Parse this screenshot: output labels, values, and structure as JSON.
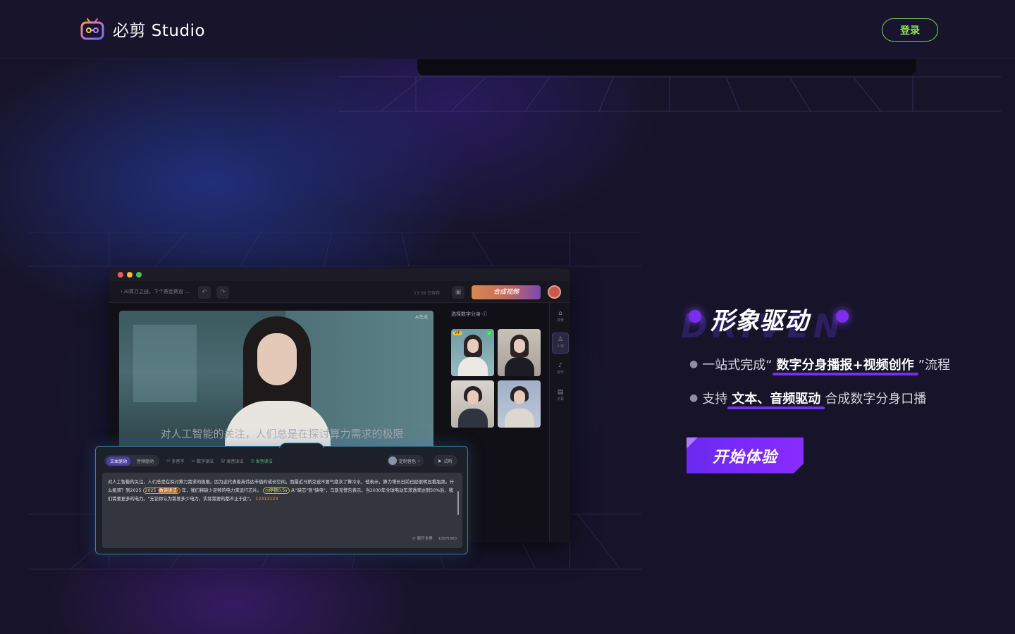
{
  "header": {
    "brand": "必剪 Studio",
    "login_label": "登录"
  },
  "app": {
    "back_label": "AI算力之战，下个赛金赛道 ...",
    "saved_label": "13:56 已保存",
    "compose_label": "合成视频",
    "preview_tag": "AI生成",
    "caption": "对人工智能的关注，人们总是在探讨算力需求的极限",
    "sidebar_title": "选择数字分身",
    "vip_label": "VIP",
    "rail": [
      {
        "label": "背景",
        "icon": "⌂"
      },
      {
        "label": "人物",
        "icon": "♙"
      },
      {
        "label": "音乐",
        "icon": "♪"
      },
      {
        "label": "字幕",
        "icon": "▤"
      }
    ],
    "editor": {
      "tabs": [
        "文本驱动",
        "音频驱动"
      ],
      "tools": [
        "多音字",
        "数字读法",
        "发音读法",
        "发音读法"
      ],
      "voice_label": "定制音色",
      "play_label": "试听",
      "text_part1": "对人工智能的关注，人们总是在探讨算力需求的极限。因为这代表着英伟达市值的成长空间。而最近马斯克说不要气绝灰了算冷水，他表示，算力增长日前已经很明显看瓶颈。什么瓶颈？到2025",
      "tag_year": "2025",
      "tag_year_in": "数读读法",
      "text_part2": "年，我们将缺少足够的电力来运行芯片。",
      "tag_pause": "停顿0.5s",
      "text_part3": "从\"缺芯\"到\"缺电\"，马斯克警告表示，当2030年全球电动车渗透率达到50%后，我们需要更多的电力。\"无论你认为需要多少电力，实际需要的都不止于此\"。",
      "text_num": "12313123",
      "full_label": "展开全屏",
      "counter": "100/5000"
    }
  },
  "feature": {
    "bg_word": "DRIVEN",
    "title": "形象驱动",
    "bullet1_pre": "一站式完成“",
    "bullet1_hl": "数字分身播报+视频创作",
    "bullet1_post": "”流程",
    "bullet2_pre": "支持",
    "bullet2_hl": "文本、音频驱动",
    "bullet2_post": "合成数字分身口播",
    "cta_label": "开始体验"
  },
  "colors": {
    "accent": "#7b2cf0",
    "login_green": "#7fd04b",
    "background": "#17142a"
  }
}
